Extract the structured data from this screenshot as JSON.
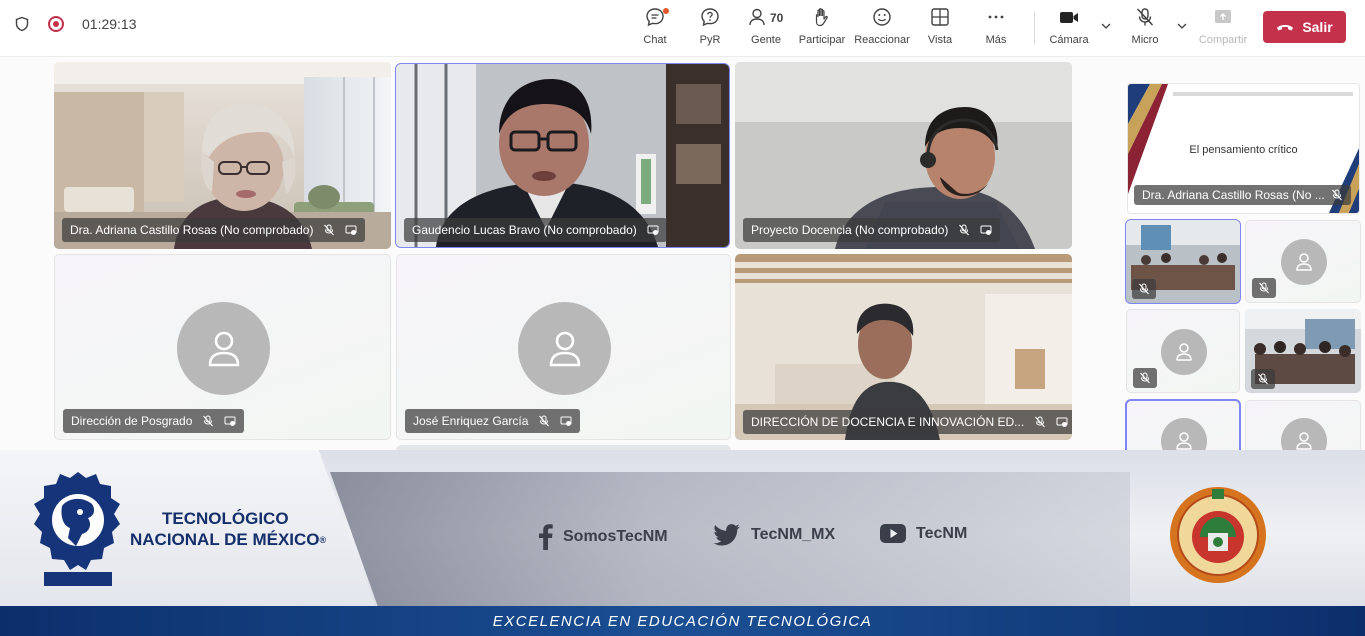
{
  "toolbar": {
    "timer": "01:29:13",
    "chat_label": "Chat",
    "qa_label": "PyR",
    "people_label": "Gente",
    "people_count": "70",
    "raise_label": "Participar",
    "react_label": "Reaccionar",
    "view_label": "Vista",
    "more_label": "Más",
    "camera_label": "Cámara",
    "mic_label": "Micro",
    "share_label": "Compartir",
    "leave_label": "Salir"
  },
  "tiles": [
    {
      "name": "Dra. Adriana Castillo Rosas (No comprobado)"
    },
    {
      "name": "Gaudencio Lucas Bravo (No comprobado)"
    },
    {
      "name": "Proyecto Docencia (No comprobado)"
    },
    {
      "name": "Dirección de Posgrado"
    },
    {
      "name": "José Enriquez García"
    },
    {
      "name": "DIRECCIÓN DE DOCENCIA E INNOVACIÓN ED..."
    }
  ],
  "gallery": {
    "slide_title": "El pensamiento crítico",
    "slide_presenter": "Dra. Adriana Castillo Rosas (No ..."
  },
  "banner": {
    "brand_line1": "TECNOLÓGICO",
    "brand_line2": "NACIONAL DE MÉXICO",
    "registered": "®",
    "facebook": "SomosTecNM",
    "twitter": "TecNM_MX",
    "youtube": "TecNM",
    "slogan": "EXCELENCIA EN EDUCACIÓN TECNOLÓGICA"
  },
  "colors": {
    "leave": "#c4314b",
    "active_border": "#7f85f5",
    "brand_blue": "#152f6a",
    "strip_blue": "#1b4f94"
  }
}
